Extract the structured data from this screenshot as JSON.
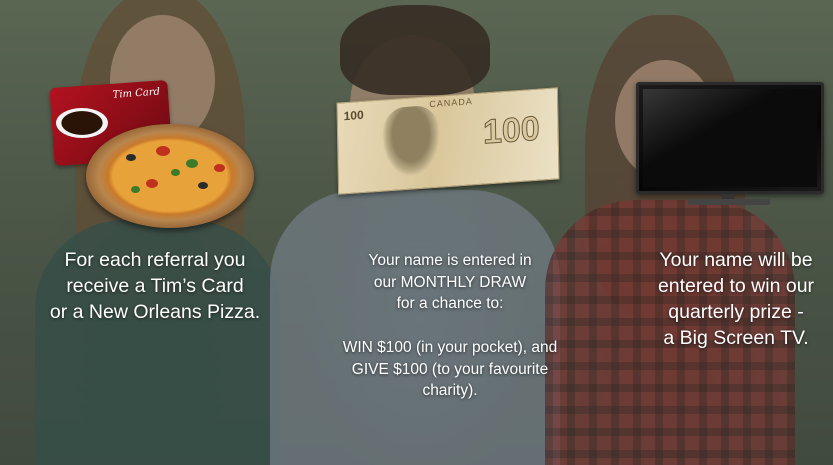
{
  "panels": [
    {
      "caption_lines": [
        "For each referral you",
        "receive a Tim’s Card",
        "or a New Orleans Pizza."
      ]
    },
    {
      "caption_lines_top": [
        "Your name is entered in",
        "our MONTHLY DRAW",
        "for a chance to:"
      ],
      "caption_lines_bottom": [
        "WIN $100 (in your pocket), and",
        "GIVE $100 (to your favourite",
        "charity)."
      ]
    },
    {
      "caption_lines": [
        "Your name will be",
        "entered to win our",
        "quarterly prize -",
        "a Big Screen TV."
      ]
    }
  ],
  "images": {
    "tim_card_label": "Tim Card",
    "bill_country": "CANADA",
    "bill_corner_value": "100",
    "bill_large_value": "100"
  }
}
